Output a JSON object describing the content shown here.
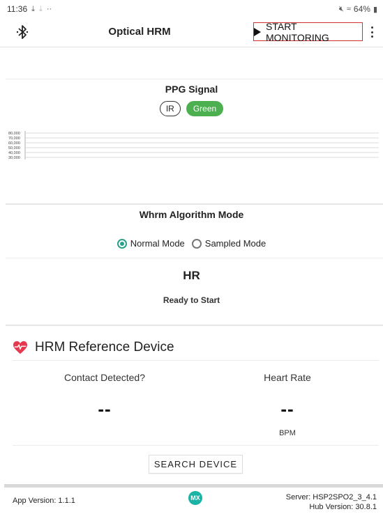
{
  "status_bar": {
    "time": "11:36",
    "icons_left": [
      "download-icon",
      "download-icon",
      "more-dots-icon"
    ],
    "battery": "64%"
  },
  "app_bar": {
    "title": "Optical HRM",
    "start_label": "START MONITORING",
    "accent_border": "#d32f2f"
  },
  "ppg": {
    "title": "PPG Signal",
    "chips": [
      {
        "label": "IR",
        "selected": false
      },
      {
        "label": "Green",
        "selected": true,
        "color": "#4caf50"
      }
    ]
  },
  "chart_data": {
    "type": "line",
    "title": "",
    "xlabel": "",
    "ylabel": "",
    "y_ticks": [
      "80,000",
      "70,000",
      "60,000",
      "50,000",
      "40,000",
      "30,000"
    ],
    "ylim": [
      30000,
      80000
    ],
    "series": [],
    "grid": true
  },
  "whrm": {
    "title": "Whrm Algorithm Mode",
    "options": [
      {
        "label": "Normal Mode",
        "selected": true
      },
      {
        "label": "Sampled Mode",
        "selected": false
      }
    ],
    "radio_color": "#2aa08a"
  },
  "hr": {
    "title": "HR",
    "status": "Ready to Start"
  },
  "reference": {
    "title": "HRM Reference Device",
    "heart_color": "#e53950",
    "contact_label": "Contact Detected?",
    "contact_value": "--",
    "heart_rate_label": "Heart Rate",
    "heart_rate_value": "--",
    "heart_rate_unit": "BPM",
    "search_label": "SEARCH DEVICE"
  },
  "footer": {
    "app_version": "App Version: 1.1.1",
    "server": "Server: HSP2SPO2_3_4.1",
    "hub_version": "Hub Version: 30.8.1",
    "logo_color": "#1bb3a6"
  }
}
